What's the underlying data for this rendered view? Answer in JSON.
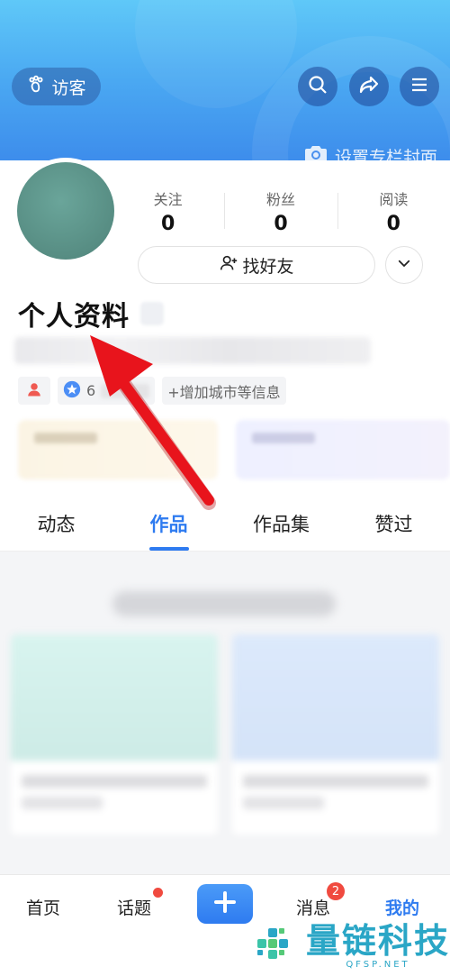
{
  "header": {
    "visitor_label": "访客",
    "cover_label": "设置专栏封面",
    "icons": [
      "footprint-icon",
      "search-icon",
      "share-icon",
      "menu-icon",
      "camera-icon"
    ]
  },
  "stats": [
    {
      "label": "关注",
      "value": "0"
    },
    {
      "label": "粉丝",
      "value": "0"
    },
    {
      "label": "阅读",
      "value": "0"
    }
  ],
  "actions": {
    "find_friends": "找好友"
  },
  "profile": {
    "name": "个人资料",
    "medal_text": "6",
    "add_info_tag": "+增加城市等信息"
  },
  "tabs": [
    {
      "label": "动态",
      "active": false
    },
    {
      "label": "作品",
      "active": true
    },
    {
      "label": "作品集",
      "active": false
    },
    {
      "label": "赞过",
      "active": false
    }
  ],
  "bottom_nav": {
    "home": "首页",
    "topics": "话题",
    "messages": "消息",
    "messages_badge": "2",
    "mine": "我的"
  },
  "watermark": {
    "text": "量链科技",
    "sub": "QFSP.NET"
  },
  "colors": {
    "accent": "#2e7bf0",
    "header_top": "#5fc8f8",
    "header_bottom": "#3a86ea",
    "badge": "#f04a3f",
    "arrow": "#e8141c"
  }
}
